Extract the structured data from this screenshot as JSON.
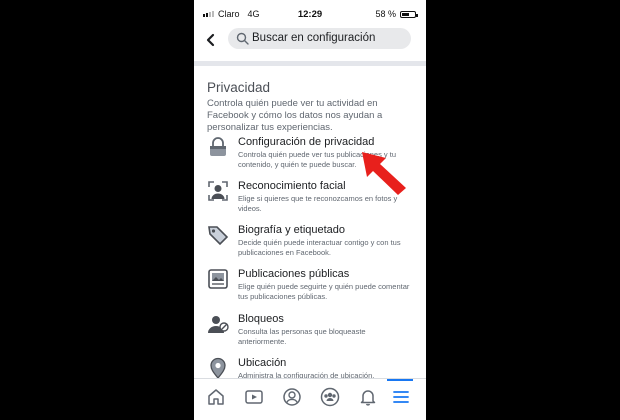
{
  "status_bar": {
    "carrier": "Claro",
    "network": "4G",
    "time": "12:29",
    "battery": "58 %",
    "battery_level": 0.58
  },
  "header": {
    "search_placeholder": "Buscar en configuración"
  },
  "section": {
    "title": "Privacidad",
    "description": "Controla quién puede ver tu actividad en Facebook y cómo los datos nos ayudan a personalizar tus experiencias."
  },
  "items": [
    {
      "title": "Configuración de privacidad",
      "description": "Controla quién puede ver tus publicaciones y tu contenido, y quién te puede buscar.",
      "icon": "lock-icon"
    },
    {
      "title": "Reconocimiento facial",
      "description": "Elige si quieres que te reconozcamos en fotos y videos.",
      "icon": "face-recognition-icon"
    },
    {
      "title": "Biografía y etiquetado",
      "description": "Decide quién puede interactuar contigo y con tus publicaciones en Facebook.",
      "icon": "tag-icon"
    },
    {
      "title": "Publicaciones públicas",
      "description": "Elige quién puede seguirte y quién puede comentar tus publicaciones públicas.",
      "icon": "public-posts-icon"
    },
    {
      "title": "Bloqueos",
      "description": "Consulta las personas que bloqueaste anteriormente.",
      "icon": "blocked-user-icon"
    },
    {
      "title": "Ubicación",
      "description": "Administra la configuración de ubicación.",
      "icon": "location-pin-icon"
    }
  ],
  "tabbar": {
    "tabs": [
      "home-icon",
      "watch-icon",
      "profile-icon",
      "groups-icon",
      "notifications-icon",
      "menu-icon"
    ],
    "active": "menu-icon"
  },
  "colors": {
    "accent": "#1877f2",
    "arrow": "#e8201c",
    "divider": "#e4e6eb"
  }
}
